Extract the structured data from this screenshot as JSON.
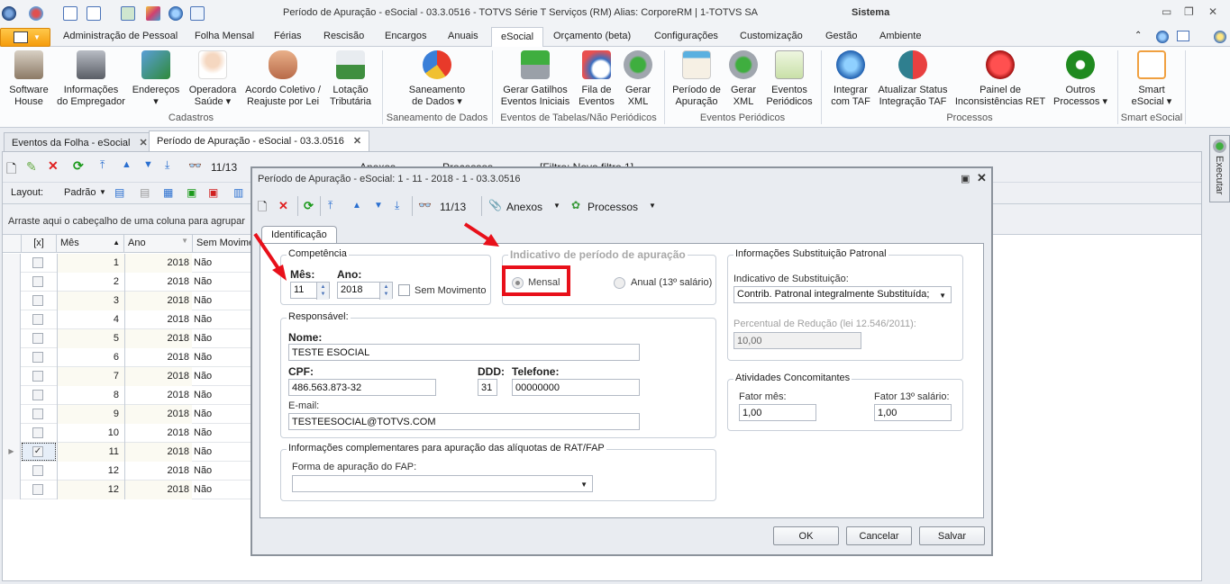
{
  "window": {
    "title": "Período de Apuração - eSocial - 03.3.0516 - TOTVS Série T Serviços (RM) Alias: CorporeRM | 1-TOTVS SA",
    "right_title": "Sistema"
  },
  "quick_access_icons": [
    "app-orb-icon",
    "theme-icon",
    "window-new-icon",
    "window-layout-icon",
    "export-icon",
    "palette-icon",
    "globe-icon",
    "copy-icon"
  ],
  "ribbon": {
    "tabs": [
      "Administração de Pessoal",
      "Folha Mensal",
      "Férias",
      "Rescisão",
      "Encargos",
      "Anuais",
      "eSocial",
      "Orçamento (beta)",
      "Configurações",
      "Customização",
      "Gestão",
      "Ambiente"
    ],
    "active_tab": "eSocial",
    "groups": [
      {
        "label": "Cadastros",
        "buttons": [
          {
            "line1": "Software",
            "line2": "House",
            "icon": "bank-building-icon"
          },
          {
            "line1": "Informações",
            "line2": "do Empregador",
            "icon": "office-building-icon"
          },
          {
            "line1": "Endereços",
            "line2": "▾",
            "icon": "world-map-icon"
          },
          {
            "line1": "Operadora",
            "line2": "Saúde ▾",
            "icon": "nurse-icon"
          },
          {
            "line1": "Acordo Coletivo /",
            "line2": "Reajuste por Lei",
            "icon": "handshake-icon"
          },
          {
            "line1": "Lotação",
            "line2": "Tributária",
            "icon": "money-chart-icon"
          }
        ]
      },
      {
        "label": "Saneamento de Dados",
        "buttons": [
          {
            "line1": "Saneamento",
            "line2": "de Dados ▾",
            "icon": "pie-check-icon"
          }
        ]
      },
      {
        "label": "Eventos de Tabelas/Não Periódicos",
        "buttons": [
          {
            "line1": "Gerar Gatilhos",
            "line2": "Eventos Iniciais",
            "icon": "download-drive-icon"
          },
          {
            "line1": "Fila de",
            "line2": "Eventos",
            "icon": "clock-queue-icon"
          },
          {
            "line1": "Gerar",
            "line2": "XML",
            "icon": "gear-refresh-icon"
          }
        ]
      },
      {
        "label": "Eventos Periódicos",
        "buttons": [
          {
            "line1": "Período de",
            "line2": "Apuração",
            "icon": "calendar-icon"
          },
          {
            "line1": "Gerar",
            "line2": "XML",
            "icon": "gear-calendar-icon"
          },
          {
            "line1": "Eventos",
            "line2": "Periódicos",
            "icon": "sheet-search-icon"
          }
        ]
      },
      {
        "label": "Processos",
        "buttons": [
          {
            "line1": "Integrar",
            "line2": "com TAF",
            "icon": "globe-gear-icon"
          },
          {
            "line1": "Atualizar Status",
            "line2": "Integração TAF",
            "icon": "sync-arrows-icon"
          },
          {
            "line1": "Painel de",
            "line2": "Inconsistências RET",
            "icon": "alert-icon"
          },
          {
            "line1": "Outros",
            "line2": "Processos ▾",
            "icon": "gear-icon"
          }
        ]
      },
      {
        "label": "Smart eSocial",
        "buttons": [
          {
            "line1": "Smart",
            "line2": "eSocial ▾",
            "icon": "smart-doc-icon"
          }
        ]
      }
    ]
  },
  "doc_tabs": [
    {
      "label": "Eventos da Folha - eSocial",
      "active": false
    },
    {
      "label": "Período de Apuração - eSocial - 03.3.0516",
      "active": true
    }
  ],
  "main_toolbar": {
    "record_counter": "11/13",
    "anexos": "Anexos",
    "processos": "Processos",
    "filter": "[Filtro: Novo filtro 1]",
    "layout_label": "Layout:",
    "layout_value": "Padrão"
  },
  "group_area_hint": "Arraste aqui o cabeçalho de uma coluna para agrupar",
  "grid": {
    "columns": [
      "[x]",
      "Mês",
      "Ano",
      "Sem Movimento"
    ],
    "rows": [
      {
        "checked": false,
        "mes": "1",
        "ano": "2018",
        "sem": "Não"
      },
      {
        "checked": false,
        "mes": "2",
        "ano": "2018",
        "sem": "Não"
      },
      {
        "checked": false,
        "mes": "3",
        "ano": "2018",
        "sem": "Não"
      },
      {
        "checked": false,
        "mes": "4",
        "ano": "2018",
        "sem": "Não"
      },
      {
        "checked": false,
        "mes": "5",
        "ano": "2018",
        "sem": "Não"
      },
      {
        "checked": false,
        "mes": "6",
        "ano": "2018",
        "sem": "Não"
      },
      {
        "checked": false,
        "mes": "7",
        "ano": "2018",
        "sem": "Não"
      },
      {
        "checked": false,
        "mes": "8",
        "ano": "2018",
        "sem": "Não"
      },
      {
        "checked": false,
        "mes": "9",
        "ano": "2018",
        "sem": "Não"
      },
      {
        "checked": false,
        "mes": "10",
        "ano": "2018",
        "sem": "Não"
      },
      {
        "checked": true,
        "mes": "11",
        "ano": "2018",
        "sem": "Não",
        "selected": true
      },
      {
        "checked": false,
        "mes": "12",
        "ano": "2018",
        "sem": "Não"
      },
      {
        "checked": false,
        "mes": "12",
        "ano": "2018",
        "sem": "Não"
      }
    ]
  },
  "side_panel": {
    "executar": "Executar"
  },
  "dialog": {
    "title": "Período de Apuração - eSocial: 1 - 11 - 2018 - 1 - 03.3.0516",
    "toolbar": {
      "counter": "11/13",
      "anexos": "Anexos",
      "processos": "Processos"
    },
    "tab": "Identificação",
    "competencia": {
      "legend": "Competência",
      "mes_label": "Mês:",
      "mes_value": "11",
      "ano_label": "Ano:",
      "ano_value": "2018",
      "sem_movimento_label": "Sem Movimento",
      "sem_movimento_checked": false
    },
    "indicativo": {
      "legend": "Indicativo de período de apuração",
      "options": [
        {
          "label": "Mensal",
          "selected": true
        },
        {
          "label": "Anual (13º salário)",
          "selected": false
        }
      ]
    },
    "responsavel": {
      "legend": "Responsável:",
      "nome_label": "Nome:",
      "nome_value": "TESTE ESOCIAL",
      "cpf_label": "CPF:",
      "cpf_value": "486.563.873-32",
      "ddd_label": "DDD:",
      "ddd_value": "31",
      "telefone_label": "Telefone:",
      "telefone_value": "00000000",
      "email_label": "E-mail:",
      "email_value": "TESTEESOCIAL@TOTVS.COM"
    },
    "rat_fap": {
      "legend": "Informações complementares para apuração das alíquotas de RAT/FAP",
      "forma_label": "Forma de apuração do FAP:",
      "forma_value": ""
    },
    "substituicao": {
      "legend": "Informações Substituição Patronal",
      "indicativo_label": "Indicativo de Substituição:",
      "indicativo_value": "Contrib. Patronal integralmente Substituída;",
      "percentual_label": "Percentual de Redução  (lei 12.546/2011):",
      "percentual_value": "10,00"
    },
    "atividades": {
      "legend": "Atividades Concomitantes",
      "fator_mes_label": "Fator mês:",
      "fator_mes_value": "1,00",
      "fator_13_label": "Fator 13º salário:",
      "fator_13_value": "1,00"
    },
    "buttons": {
      "ok": "OK",
      "cancelar": "Cancelar",
      "salvar": "Salvar"
    }
  },
  "annotation_color": "#e8101a"
}
